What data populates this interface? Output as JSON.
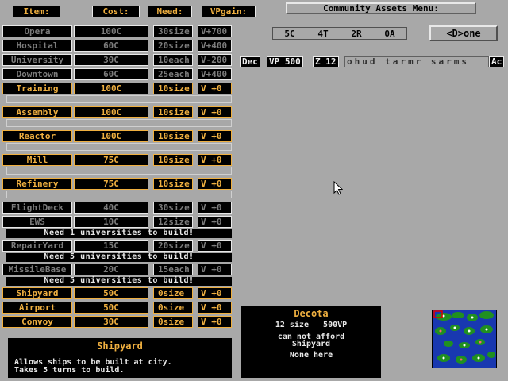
{
  "headers": {
    "item": "Item:",
    "cost": "Cost:",
    "need": "Need:",
    "vpgain": "VPgain:"
  },
  "rows": [
    {
      "name": "Opera",
      "cost": "100C",
      "need": "30size",
      "vp": "V+700",
      "state": "off"
    },
    {
      "name": "Hospital",
      "cost": "60C",
      "need": "20size",
      "vp": "V+400",
      "state": "off"
    },
    {
      "name": "University",
      "cost": "30C",
      "need": "10each",
      "vp": "V-200",
      "state": "off"
    },
    {
      "name": "Downtown",
      "cost": "60C",
      "need": "25each",
      "vp": "V+400",
      "state": "off"
    },
    {
      "name": "Training",
      "cost": "100C",
      "need": "10size",
      "vp": "V  +0",
      "state": "on"
    },
    {
      "name": "Assembly",
      "cost": "100C",
      "need": "10size",
      "vp": "V  +0",
      "state": "on"
    },
    {
      "name": "Reactor",
      "cost": "100C",
      "need": "10size",
      "vp": "V  +0",
      "state": "on"
    },
    {
      "name": "Mill",
      "cost": "75C",
      "need": "10size",
      "vp": "V  +0",
      "state": "on"
    },
    {
      "name": "Refinery",
      "cost": "75C",
      "need": "10size",
      "vp": "V  +0",
      "state": "on"
    },
    {
      "name": "FlightDeck",
      "cost": "40C",
      "need": "30size",
      "vp": "V  +0",
      "state": "off"
    },
    {
      "name": "EWS",
      "cost": "10C",
      "need": "12size",
      "vp": "V  +0",
      "state": "off"
    },
    {
      "name": "RepairYard",
      "cost": "15C",
      "need": "20size",
      "vp": "V  +0",
      "state": "off"
    },
    {
      "name": "MissileBase",
      "cost": "20C",
      "need": "15each",
      "vp": "V  +0",
      "state": "off"
    },
    {
      "name": "Shipyard",
      "cost": "50C",
      "need": "0size",
      "vp": "V  +0",
      "state": "on"
    },
    {
      "name": "Airport",
      "cost": "50C",
      "need": "0size",
      "vp": "V  +0",
      "state": "on"
    },
    {
      "name": "Convoy",
      "cost": "30C",
      "need": "0size",
      "vp": "V  +0",
      "state": "on"
    }
  ],
  "warnings": [
    "Need  1 universities to build!",
    "Need  5 universities to build!",
    "Need  5 universities to build!"
  ],
  "menu_title": "Community Assets Menu:",
  "resources": {
    "c": "5C",
    "t": "4T",
    "r": "2R",
    "a": "0A"
  },
  "done_label": "<D>one",
  "tabs": {
    "dec": "Dec",
    "vp": "VP 500",
    "z": "Z 12",
    "rest": "ohud tarmr sarms",
    "ac": "Ac"
  },
  "desc": {
    "title": "Shipyard",
    "line1": "Allows ships to be built at city.",
    "line2": "Takes 5 turns to build."
  },
  "city": {
    "name": "Decota",
    "size": "12 size",
    "vp": "500VP",
    "afford1": "can not afford",
    "afford2": "Shipyard",
    "here": "None here"
  },
  "colors": {
    "accent": "#f0b040",
    "panel": "#000000",
    "bg": "#a8a8a8",
    "map_water": "#1838b0",
    "map_land": "#209020"
  }
}
